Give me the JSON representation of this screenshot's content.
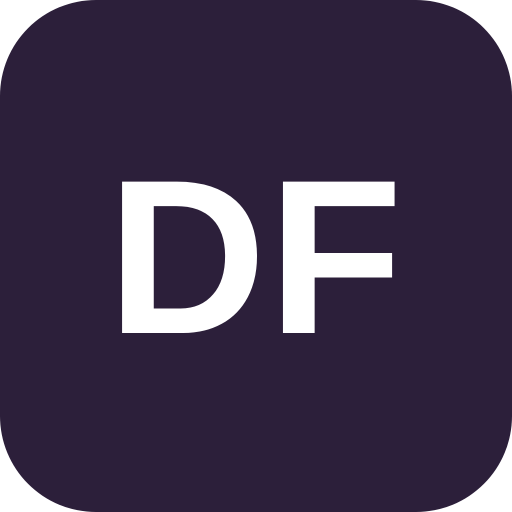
{
  "app_icon": {
    "monogram": "DF",
    "background_color": "#2c1f3a",
    "text_color": "#ffffff"
  }
}
